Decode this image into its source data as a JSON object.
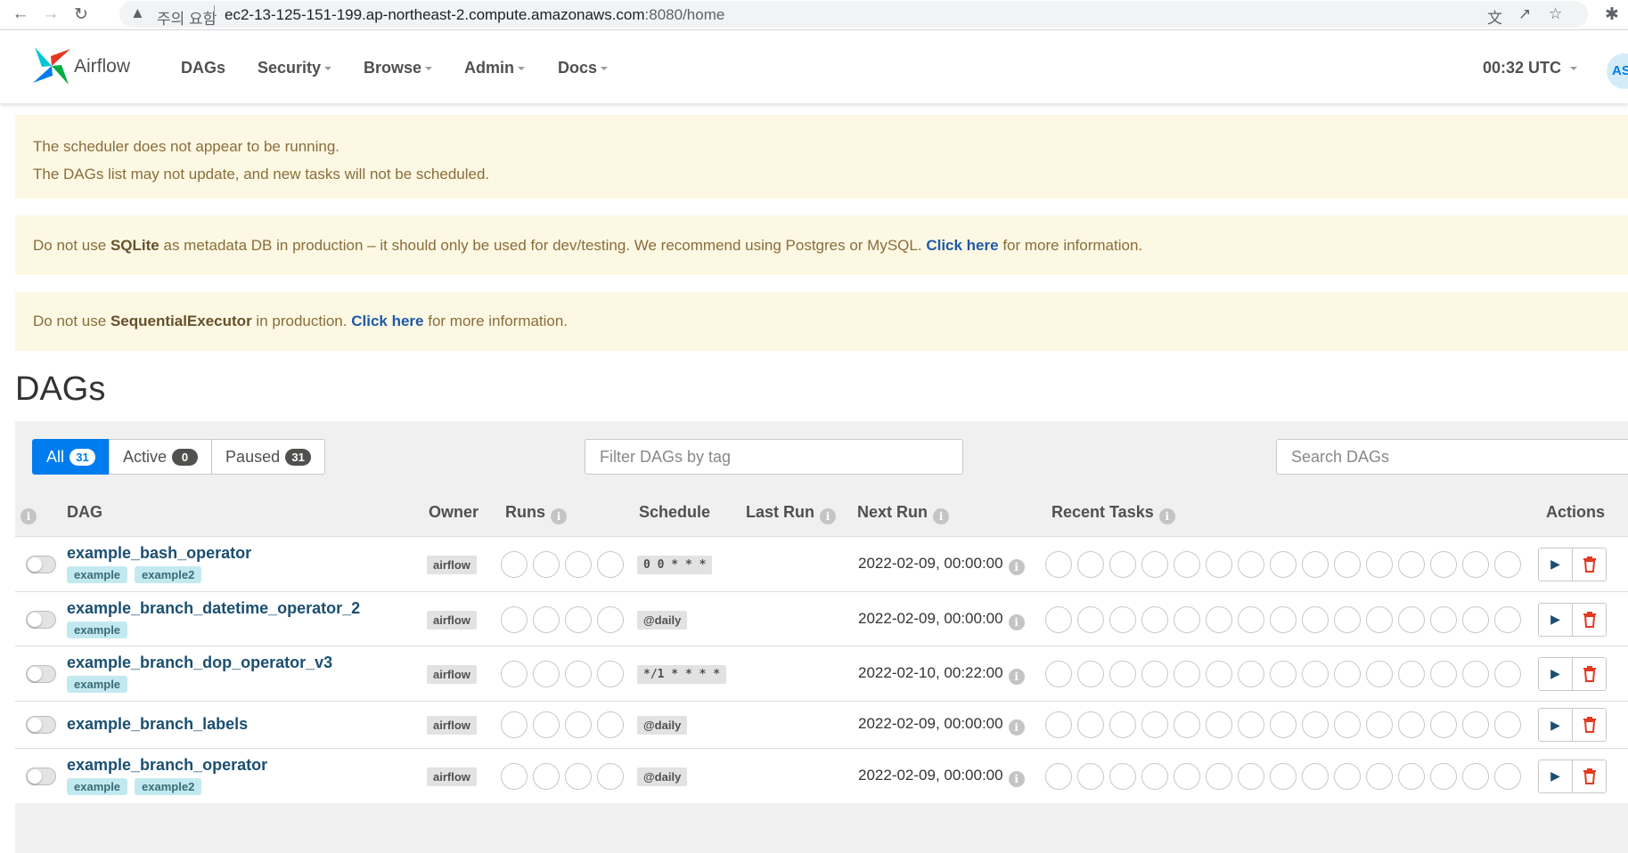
{
  "browser": {
    "security_label": "주의 요함",
    "url_host": "ec2-13-125-151-199.ap-northeast-2.compute.amazonaws.com",
    "url_rest": ":8080/home"
  },
  "navbar": {
    "brand": "Airflow",
    "items": [
      {
        "label": "DAGs"
      },
      {
        "label": "Security"
      },
      {
        "label": "Browse"
      },
      {
        "label": "Admin"
      },
      {
        "label": "Docs"
      }
    ],
    "time": "00:32 UTC",
    "avatar": "AS"
  },
  "alerts": {
    "scheduler_line1": "The scheduler does not appear to be running.",
    "scheduler_line2": "The DAGs list may not update, and new tasks will not be scheduled.",
    "sqlite_pre": "Do not use",
    "sqlite_bold": "SQLite",
    "sqlite_mid": "as metadata DB in production – it should only be used for dev/testing. We recommend using Postgres or MySQL.",
    "sqlite_link": "Click here",
    "sqlite_post": "for more information.",
    "executor_pre": "Do not use",
    "executor_bold": "SequentialExecutor",
    "executor_mid": "in production.",
    "executor_link": "Click here",
    "executor_post": "for more information."
  },
  "page": {
    "title": "DAGs"
  },
  "filters": {
    "all_label": "All",
    "all_count": "31",
    "active_label": "Active",
    "active_count": "0",
    "paused_label": "Paused",
    "paused_count": "31",
    "tag_placeholder": "Filter DAGs by tag",
    "search_placeholder": "Search DAGs"
  },
  "table": {
    "headers": {
      "dag": "DAG",
      "owner": "Owner",
      "runs": "Runs",
      "schedule": "Schedule",
      "last_run": "Last Run",
      "next_run": "Next Run",
      "recent_tasks": "Recent Tasks",
      "actions": "Actions"
    },
    "rows": [
      {
        "name": "example_bash_operator",
        "tags": [
          "example",
          "example2"
        ],
        "owner": "airflow",
        "schedule": "0 0 * * *",
        "next_run": "2022-02-09, 00:00:00"
      },
      {
        "name": "example_branch_datetime_operator_2",
        "tags": [
          "example"
        ],
        "owner": "airflow",
        "schedule": "@daily",
        "next_run": "2022-02-09, 00:00:00"
      },
      {
        "name": "example_branch_dop_operator_v3",
        "tags": [
          "example"
        ],
        "owner": "airflow",
        "schedule": "*/1 * * * *",
        "next_run": "2022-02-10, 00:22:00"
      },
      {
        "name": "example_branch_labels",
        "tags": [],
        "owner": "airflow",
        "schedule": "@daily",
        "next_run": "2022-02-09, 00:00:00"
      },
      {
        "name": "example_branch_operator",
        "tags": [
          "example",
          "example2"
        ],
        "owner": "airflow",
        "schedule": "@daily",
        "next_run": "2022-02-09, 00:00:00"
      }
    ]
  },
  "colors": {
    "accent": "#017cee",
    "alert_bg": "#fcf8e3",
    "alert_text": "#8a6d3b",
    "dag_link": "#1b4f72",
    "tag_bg": "#c3e9f0",
    "delete": "#e43921"
  }
}
